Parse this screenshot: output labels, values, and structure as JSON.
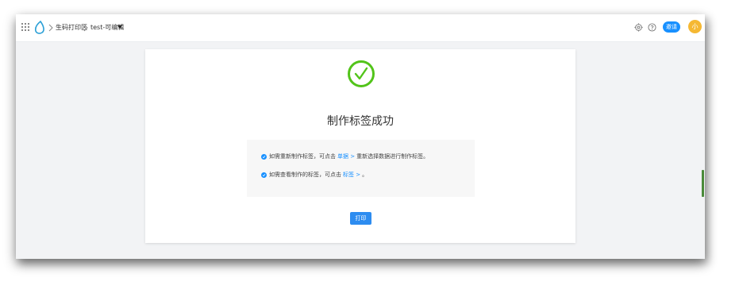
{
  "breadcrumb": {
    "app": "生码打印区",
    "project": "test-可编辑"
  },
  "header": {
    "badge_label": "邀请",
    "avatar_initial": "小"
  },
  "result": {
    "title": "制作标签成功",
    "line1": {
      "prefix": "如需重新制作标签，可点击",
      "link": "单据 >",
      "suffix": "重新选择数据进行制作标签。"
    },
    "line2": {
      "prefix": "如需查看制作的标签，可点击",
      "link": "标签 >",
      "suffix": "。"
    },
    "print_label": "打印"
  },
  "colors": {
    "success": "#52c41a",
    "primary": "#1890ff",
    "avatar": "#f5b833"
  }
}
